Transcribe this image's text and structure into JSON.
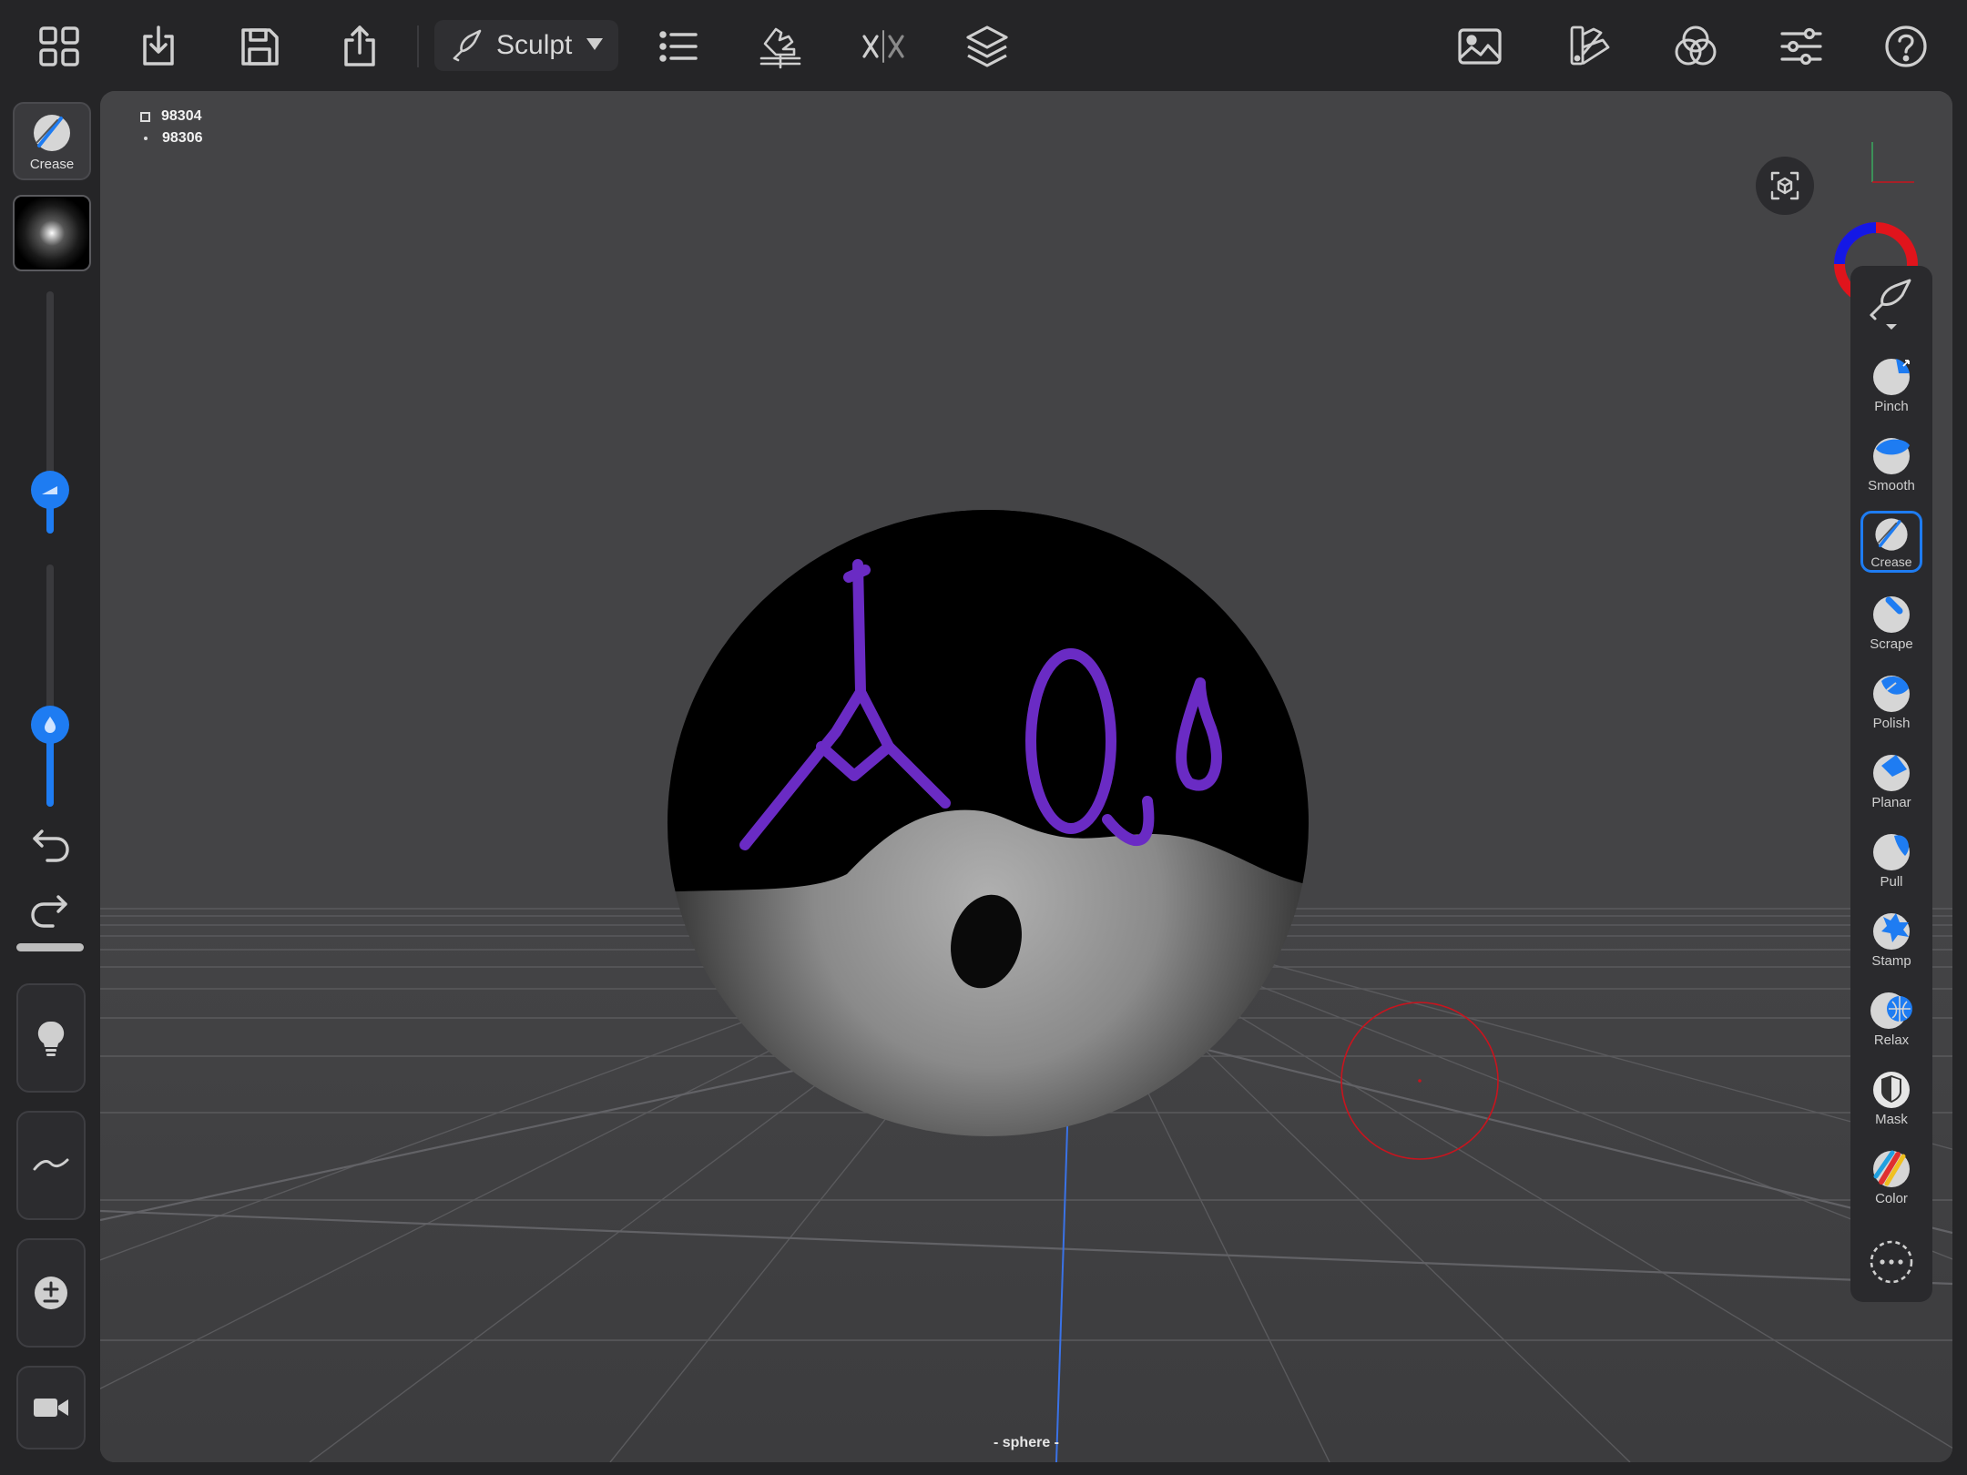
{
  "app": {
    "mode_label": "Sculpt",
    "object_name": "- sphere -",
    "stats": {
      "faces": "98304",
      "vertices": "98306"
    }
  },
  "toolbar": {
    "left_buttons": [
      "grid-menu-icon",
      "import-icon",
      "save-icon",
      "share-icon"
    ],
    "mode_icon": "brush-icon",
    "middle_buttons": [
      "scene-list-icon",
      "stencil-hand-icon",
      "symmetry-icon",
      "layers-icon"
    ],
    "right_buttons": [
      "background-image-icon",
      "material-palette-icon",
      "render-color-icon",
      "settings-sliders-icon",
      "help-icon"
    ]
  },
  "left_panel": {
    "current_tool_label": "Crease",
    "radius_level": 0.18,
    "intensity_level": 0.34
  },
  "tools": [
    {
      "label": "Pinch",
      "icon": "pinch-icon"
    },
    {
      "label": "Smooth",
      "icon": "smooth-icon"
    },
    {
      "label": "Crease",
      "icon": "crease-icon",
      "selected": true
    },
    {
      "label": "Scrape",
      "icon": "scrape-icon"
    },
    {
      "label": "Polish",
      "icon": "polish-icon"
    },
    {
      "label": "Planar",
      "icon": "planar-icon"
    },
    {
      "label": "Pull",
      "icon": "pull-icon"
    },
    {
      "label": "Stamp",
      "icon": "stamp-icon"
    },
    {
      "label": "Relax",
      "icon": "relax-icon"
    },
    {
      "label": "Mask",
      "icon": "mask-icon"
    },
    {
      "label": "Color",
      "icon": "color-icon"
    }
  ],
  "colors": {
    "accent": "#1e7cf2",
    "background": "#252527",
    "viewport": "#444446",
    "paint_purple": "#6a2bc4",
    "cursor_red": "#c8141e"
  }
}
